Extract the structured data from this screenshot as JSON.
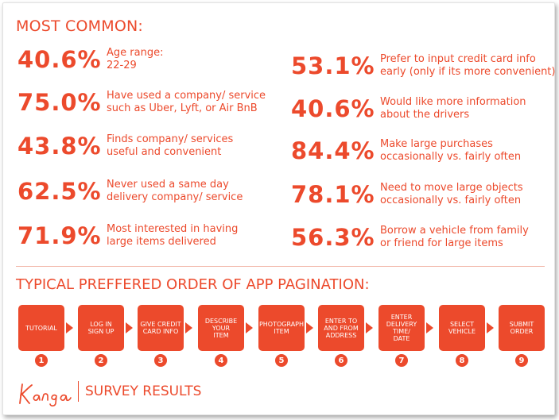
{
  "heading": "MOST COMMON:",
  "stats_left": [
    {
      "pct": "40.6%",
      "desc": "Age range:\n22-29"
    },
    {
      "pct": "75.0%",
      "desc": "Have used a company/ service\nsuch as Uber, Lyft, or Air BnB"
    },
    {
      "pct": "43.8%",
      "desc": "Finds company/ services\nuseful and convenient"
    },
    {
      "pct": "62.5%",
      "desc": "Never used a same day\ndelivery company/ service"
    },
    {
      "pct": "71.9%",
      "desc": "Most interested in having\nlarge items delivered"
    }
  ],
  "stats_right": [
    {
      "pct": "53.1%",
      "desc": "Prefer to input credit card info\nearly (only if its more convenient)"
    },
    {
      "pct": "40.6%",
      "desc": "Would like more information\nabout the drivers"
    },
    {
      "pct": "84.4%",
      "desc": "Make large purchases\noccasionally vs. fairly often"
    },
    {
      "pct": "78.1%",
      "desc": "Need to move large objects\noccasionally vs. fairly often"
    },
    {
      "pct": "56.3%",
      "desc": "Borrow a vehicle from family\nor friend for large items"
    }
  ],
  "pagination_heading": "TYPICAL PREFFERED ORDER OF APP PAGINATION:",
  "steps": [
    {
      "label": "TUTORIAL",
      "num": "1"
    },
    {
      "label": "LOG IN\nSIGN UP",
      "num": "2"
    },
    {
      "label": "GIVE CREDIT\nCARD INFO",
      "num": "3"
    },
    {
      "label": "DESCRIBE\nYOUR\nITEM",
      "num": "4"
    },
    {
      "label": "PHOTOGRAPH\nITEM",
      "num": "5"
    },
    {
      "label": "ENTER TO\nAND FROM\nADDRESS",
      "num": "6"
    },
    {
      "label": "ENTER\nDELIVERY\nTIME/\nDATE",
      "num": "7"
    },
    {
      "label": "SELECT\nVEHICLE",
      "num": "8"
    },
    {
      "label": "SUBMIT\nORDER",
      "num": "9"
    }
  ],
  "footer": {
    "logo": "Kanga",
    "title": "SURVEY RESULTS"
  },
  "colors": {
    "accent": "#ec4a2c"
  }
}
